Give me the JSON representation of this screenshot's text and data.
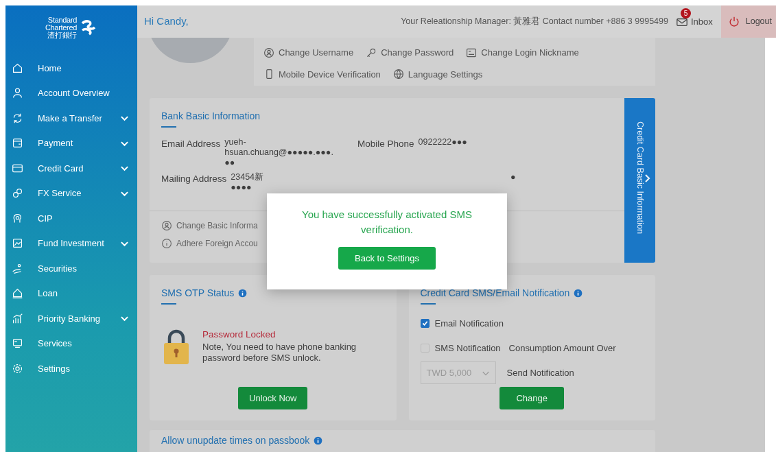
{
  "sidebar": {
    "logo": {
      "lines": [
        "Standard",
        "Chartered",
        "渣打銀行"
      ]
    },
    "items": [
      {
        "label": "Home",
        "expandable": false
      },
      {
        "label": "Account Overview",
        "expandable": false
      },
      {
        "label": "Make a Transfer",
        "expandable": true
      },
      {
        "label": "Payment",
        "expandable": true
      },
      {
        "label": "Credit Card",
        "expandable": true
      },
      {
        "label": "FX Service",
        "expandable": true
      },
      {
        "label": "CIP",
        "expandable": false
      },
      {
        "label": "Fund Investment",
        "expandable": true
      },
      {
        "label": "Securities",
        "expandable": false
      },
      {
        "label": "Loan",
        "expandable": false
      },
      {
        "label": "Priority Banking",
        "expandable": true
      },
      {
        "label": "Services",
        "expandable": false
      },
      {
        "label": "Settings",
        "expandable": false
      }
    ]
  },
  "topbar": {
    "greeting": "Hi Candy,",
    "manager_info": "Your Releationship Manager: 黃雅君 Contact number +886 3 9995499",
    "inbox": {
      "label": "Inbox",
      "count": "5"
    },
    "logout": "Logout"
  },
  "profile_links": [
    {
      "label": "Change Username"
    },
    {
      "label": "Change Password"
    },
    {
      "label": "Change Login Nickname"
    },
    {
      "label": "Mobile Device Verification"
    },
    {
      "label": "Language Settings"
    }
  ],
  "bank_info": {
    "title": "Bank Basic Information",
    "fields": [
      {
        "label": "Email Address",
        "value": "yueh-hsuan.chuang@●●●●●.●●●.●●"
      },
      {
        "label": "Mobile Phone",
        "value": "0922222●●●"
      },
      {
        "label": "Mailing Address",
        "value_lines": [
          "23454新",
          "●●●●"
        ]
      }
    ],
    "trailing_mark": "●",
    "links": [
      {
        "label": "Change Basic Informa"
      },
      {
        "label": "Adhere Foreign Accou"
      }
    ],
    "side_tab": "Credit Card Basic Information"
  },
  "sms_otp": {
    "title": "SMS OTP Status",
    "status": "Password Locked",
    "note": "Note, You need to have phone banking password before SMS unlock.",
    "button": "Unlock Now"
  },
  "notification": {
    "title": "Credit Card SMS/Email Notification",
    "options": [
      {
        "label": "Email Notification",
        "checked": true
      },
      {
        "label": "SMS Notification",
        "checked": false
      }
    ],
    "amount_label": "Consumption Amount Over",
    "amount": "TWD 5,000",
    "send_label": "Send Notification",
    "button": "Change"
  },
  "passbook": {
    "title": "Allow unupdate times on passbook"
  },
  "modal": {
    "message": "You have successfully activated SMS verification.",
    "button": "Back to Settings"
  }
}
